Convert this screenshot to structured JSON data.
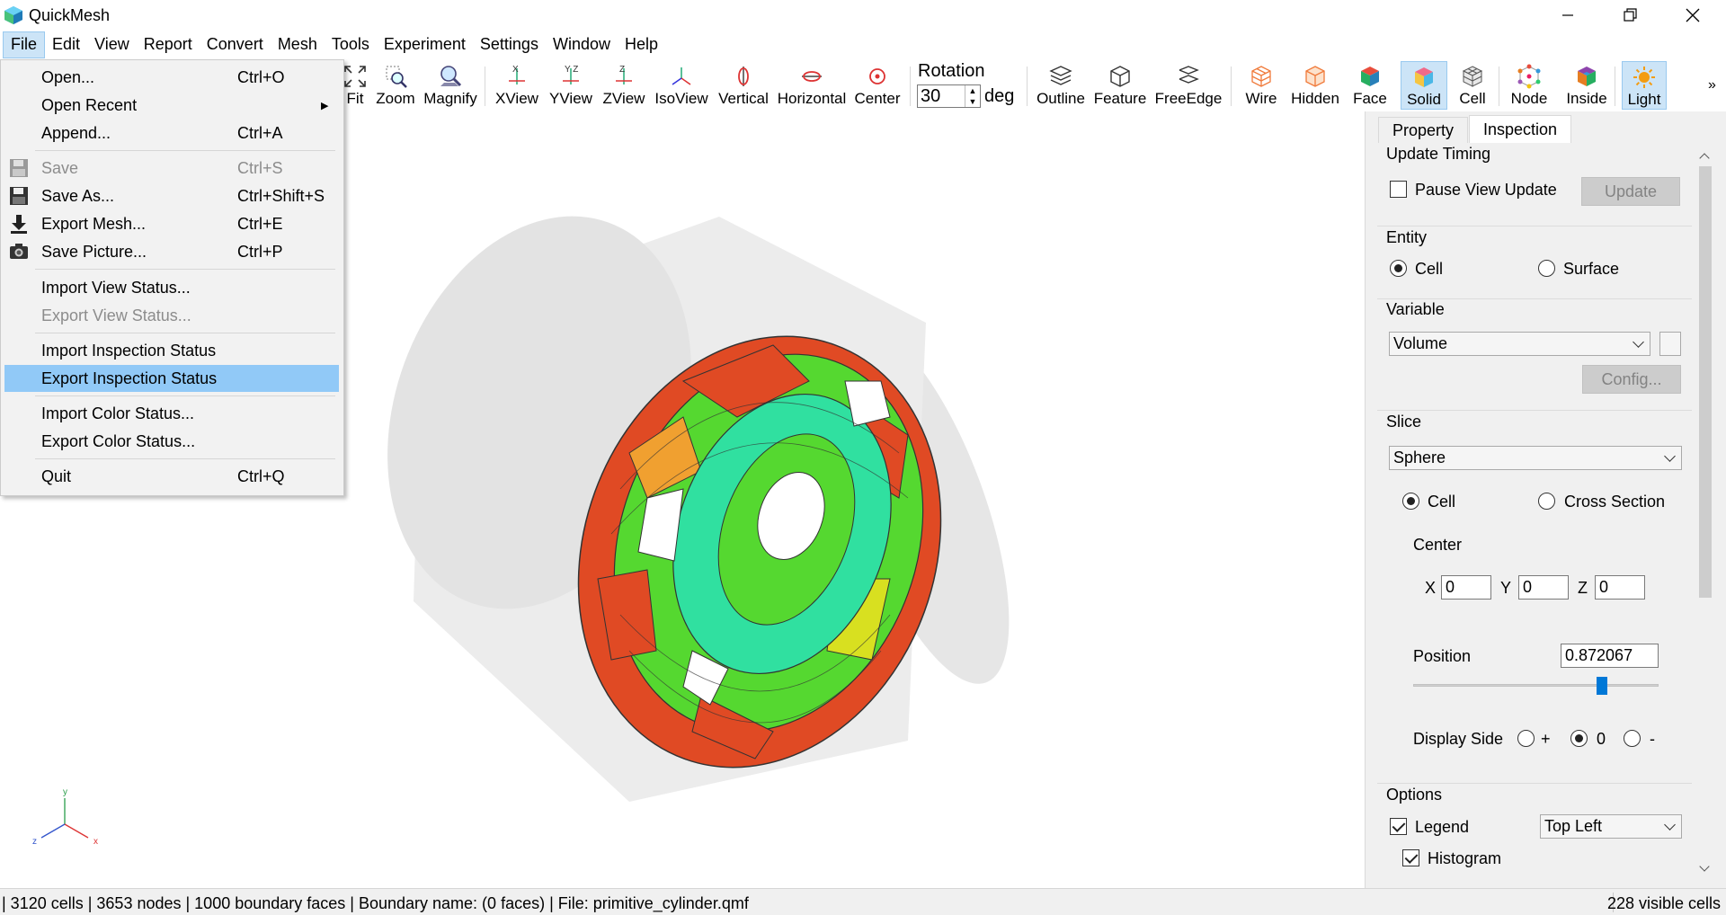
{
  "window": {
    "title": "QuickMesh",
    "minimize_icon": "minimize-icon",
    "restore_icon": "restore-icon",
    "close_icon": "close-icon"
  },
  "menubar": [
    "File",
    "Edit",
    "View",
    "Report",
    "Convert",
    "Mesh",
    "Tools",
    "Experiment",
    "Settings",
    "Window",
    "Help"
  ],
  "toolbar": {
    "fit": "Fit",
    "zoom": "Zoom",
    "magnify": "Magnify",
    "xview": "XView",
    "yview": "YView",
    "zview": "ZView",
    "isoview": "IsoView",
    "vertical": "Vertical",
    "horizontal": "Horizontal",
    "center": "Center",
    "rotation_label": "Rotation",
    "rotation_value": "30",
    "rotation_unit": "deg",
    "outline": "Outline",
    "feature": "Feature",
    "freeedge": "FreeEdge",
    "wire": "Wire",
    "hidden": "Hidden",
    "face": "Face",
    "solid": "Solid",
    "cell": "Cell",
    "node": "Node",
    "inside": "Inside",
    "light": "Light",
    "more": "»"
  },
  "file_menu": {
    "open": {
      "label": "Open...",
      "shortcut": "Ctrl+O"
    },
    "open_recent": {
      "label": "Open Recent"
    },
    "append": {
      "label": "Append...",
      "shortcut": "Ctrl+A"
    },
    "save": {
      "label": "Save",
      "shortcut": "Ctrl+S"
    },
    "save_as": {
      "label": "Save As...",
      "shortcut": "Ctrl+Shift+S"
    },
    "export_mesh": {
      "label": "Export Mesh...",
      "shortcut": "Ctrl+E"
    },
    "save_picture": {
      "label": "Save Picture...",
      "shortcut": "Ctrl+P"
    },
    "import_view": {
      "label": "Import View Status..."
    },
    "export_view": {
      "label": "Export View Status..."
    },
    "import_inspection": {
      "label": "Import Inspection Status"
    },
    "export_inspection": {
      "label": "Export Inspection Status"
    },
    "import_color": {
      "label": "Import Color Status..."
    },
    "export_color": {
      "label": "Export Color Status..."
    },
    "quit": {
      "label": "Quit",
      "shortcut": "Ctrl+Q"
    }
  },
  "axes": {
    "x": "x",
    "y": "y",
    "z": "z"
  },
  "panel": {
    "tabs": [
      "Property",
      "Inspection"
    ],
    "update_timing": {
      "title": "Update Timing",
      "pause_label": "Pause View Update",
      "update_button": "Update"
    },
    "entity": {
      "title": "Entity",
      "cell": "Cell",
      "surface": "Surface"
    },
    "variable": {
      "title": "Variable",
      "selected": "Volume",
      "config_button": "Config..."
    },
    "slice": {
      "title": "Slice",
      "selected": "Sphere",
      "cell": "Cell",
      "cross_section": "Cross Section",
      "center_label": "Center",
      "x_label": "X",
      "x_value": "0",
      "y_label": "Y",
      "y_value": "0",
      "z_label": "Z",
      "z_value": "0",
      "position_label": "Position",
      "position_value": "0.872067",
      "slider_fraction": 0.77,
      "display_side_label": "Display Side",
      "side_plus": "+",
      "side_zero": "0",
      "side_minus": "-"
    },
    "options": {
      "title": "Options",
      "legend_label": "Legend",
      "legend_position": "Top Left",
      "histogram_label": "Histogram"
    }
  },
  "status": {
    "left": "| 3120 cells | 3653 nodes | 1000 boundary faces |  Boundary name:  (0 faces) | File: primitive_cylinder.qmf",
    "right": "228 visible cells"
  },
  "colors": {
    "accent": "#0078d7",
    "highlight": "#91c9f7",
    "pressed": "#cce4f7",
    "mesh_red": "#e04a24",
    "mesh_orange": "#f0a030",
    "mesh_yellow": "#d8e020",
    "mesh_green": "#55d830",
    "mesh_teal": "#30e0a0"
  }
}
